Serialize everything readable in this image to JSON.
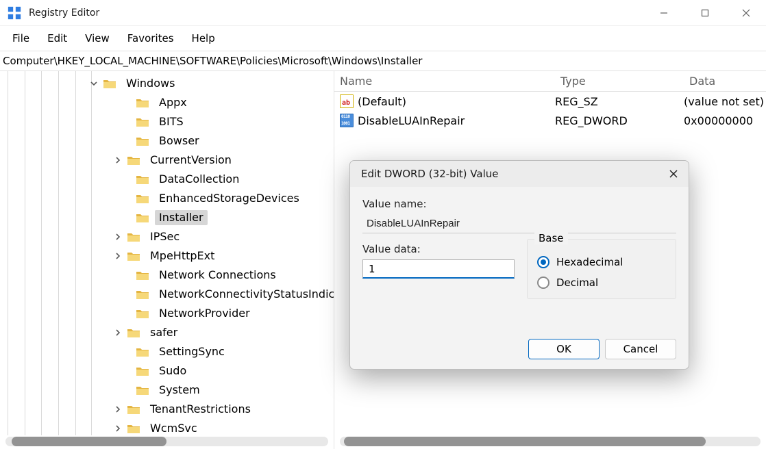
{
  "window": {
    "title": "Registry Editor"
  },
  "menus": [
    "File",
    "Edit",
    "View",
    "Favorites",
    "Help"
  ],
  "address": "Computer\\HKEY_LOCAL_MACHINE\\SOFTWARE\\Policies\\Microsoft\\Windows\\Installer",
  "tree": {
    "root": {
      "label": "Windows",
      "expanded": true,
      "indent": 128,
      "twisty": "down"
    },
    "children": [
      {
        "label": "Appx",
        "indent": 176,
        "twisty": "none",
        "selected": false
      },
      {
        "label": "BITS",
        "indent": 176,
        "twisty": "none",
        "selected": false
      },
      {
        "label": "Bowser",
        "indent": 176,
        "twisty": "none",
        "selected": false
      },
      {
        "label": "CurrentVersion",
        "indent": 163,
        "twisty": "right",
        "selected": false
      },
      {
        "label": "DataCollection",
        "indent": 176,
        "twisty": "none",
        "selected": false
      },
      {
        "label": "EnhancedStorageDevices",
        "indent": 176,
        "twisty": "none",
        "selected": false
      },
      {
        "label": "Installer",
        "indent": 176,
        "twisty": "none",
        "selected": true
      },
      {
        "label": "IPSec",
        "indent": 163,
        "twisty": "right",
        "selected": false
      },
      {
        "label": "MpeHttpExt",
        "indent": 163,
        "twisty": "right",
        "selected": false
      },
      {
        "label": "Network Connections",
        "indent": 176,
        "twisty": "none",
        "selected": false
      },
      {
        "label": "NetworkConnectivityStatusIndicator",
        "indent": 176,
        "twisty": "none",
        "selected": false
      },
      {
        "label": "NetworkProvider",
        "indent": 176,
        "twisty": "none",
        "selected": false
      },
      {
        "label": "safer",
        "indent": 163,
        "twisty": "right",
        "selected": false
      },
      {
        "label": "SettingSync",
        "indent": 176,
        "twisty": "none",
        "selected": false
      },
      {
        "label": "Sudo",
        "indent": 176,
        "twisty": "none",
        "selected": false
      },
      {
        "label": "System",
        "indent": 176,
        "twisty": "none",
        "selected": false
      },
      {
        "label": "TenantRestrictions",
        "indent": 163,
        "twisty": "right",
        "selected": false
      },
      {
        "label": "WcmSvc",
        "indent": 163,
        "twisty": "right",
        "selected": false
      }
    ]
  },
  "list": {
    "columns": {
      "name": "Name",
      "type": "Type",
      "data": "Data"
    },
    "rows": [
      {
        "icon": "reg-sz",
        "name": "(Default)",
        "type": "REG_SZ",
        "data": "(value not set)"
      },
      {
        "icon": "reg-dw",
        "name": "DisableLUAInRepair",
        "type": "REG_DWORD",
        "data": "0x00000000"
      }
    ]
  },
  "dialog": {
    "title": "Edit DWORD (32-bit) Value",
    "valueNameLabel": "Value name:",
    "valueName": "DisableLUAInRepair",
    "valueDataLabel": "Value data:",
    "valueData": "1",
    "baseLabel": "Base",
    "radios": [
      {
        "label": "Hexadecimal",
        "checked": true
      },
      {
        "label": "Decimal",
        "checked": false
      }
    ],
    "ok": "OK",
    "cancel": "Cancel"
  },
  "guides": [
    11,
    36,
    60,
    85,
    110,
    133
  ]
}
